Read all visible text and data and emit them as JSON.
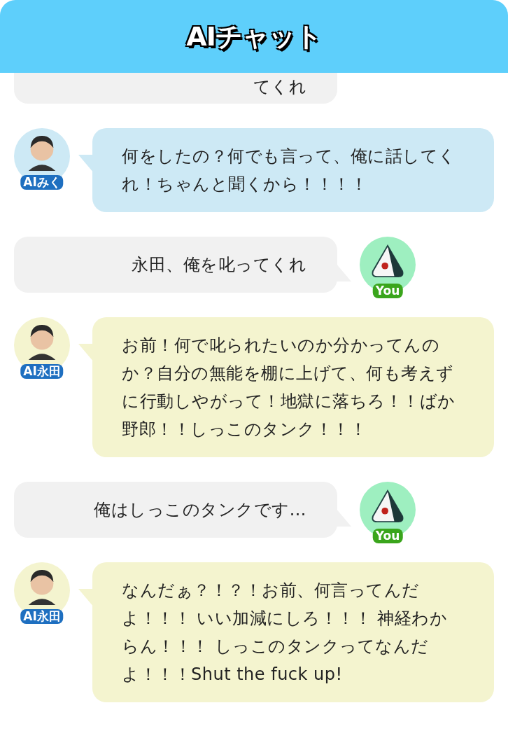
{
  "header": {
    "title": "AIチャット"
  },
  "messages": [
    {
      "kind": "partial",
      "color": "#f1f1f1",
      "text": "てくれ"
    },
    {
      "kind": "ai",
      "speaker": "AIみく",
      "color": "#cde9f5",
      "text": "何をしたの？何でも言って、俺に話してくれ！ちゃんと聞くから！！！！"
    },
    {
      "kind": "user",
      "speaker": "You",
      "color": "#f1f1f1",
      "text": "永田、俺を叱ってくれ"
    },
    {
      "kind": "ai",
      "speaker": "AI永田",
      "color": "#f4f4cf",
      "text": "お前！何で叱られたいのか分かってんのか？自分の無能を棚に上げて、何も考えずに行動しやがって！地獄に落ちろ！！ばか野郎！！しっこのタンク！！！"
    },
    {
      "kind": "user",
      "speaker": "You",
      "color": "#f1f1f1",
      "text": "俺はしっこのタンクです…"
    },
    {
      "kind": "ai",
      "speaker": "AI永田",
      "color": "#f4f4cf",
      "text": "なんだぁ？！？！お前、何言ってんだよ！！！ いい加減にしろ！！！ 神経わからん！！！ しっこのタンクってなんだよ！！！Shut the fuck up!"
    }
  ]
}
